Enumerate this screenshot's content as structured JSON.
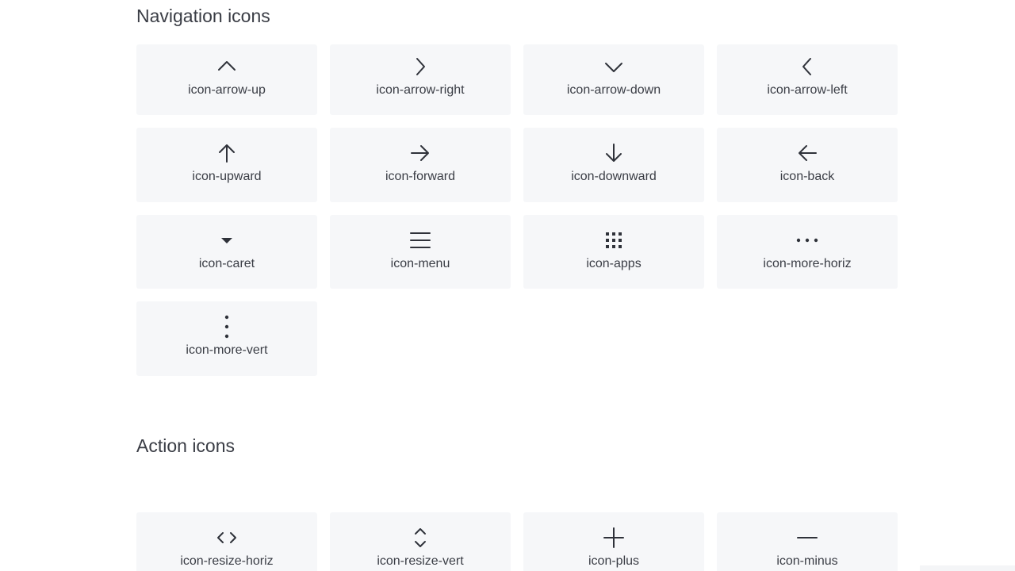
{
  "sections": [
    {
      "title": "Navigation icons",
      "icons": [
        {
          "label": "icon-arrow-up",
          "icon": "chevron-up-icon"
        },
        {
          "label": "icon-arrow-right",
          "icon": "chevron-right-icon"
        },
        {
          "label": "icon-arrow-down",
          "icon": "chevron-down-icon"
        },
        {
          "label": "icon-arrow-left",
          "icon": "chevron-left-icon"
        },
        {
          "label": "icon-upward",
          "icon": "arrow-up-icon"
        },
        {
          "label": "icon-forward",
          "icon": "arrow-right-icon"
        },
        {
          "label": "icon-downward",
          "icon": "arrow-down-icon"
        },
        {
          "label": "icon-back",
          "icon": "arrow-left-icon"
        },
        {
          "label": "icon-caret",
          "icon": "caret-down-icon"
        },
        {
          "label": "icon-menu",
          "icon": "hamburger-menu-icon"
        },
        {
          "label": "icon-apps",
          "icon": "apps-grid-icon"
        },
        {
          "label": "icon-more-horiz",
          "icon": "more-horizontal-icon"
        },
        {
          "label": "icon-more-vert",
          "icon": "more-vertical-icon"
        }
      ]
    },
    {
      "title": "Action icons",
      "icons": [
        {
          "label": "icon-resize-horiz",
          "icon": "resize-horizontal-icon"
        },
        {
          "label": "icon-resize-vert",
          "icon": "resize-vertical-icon"
        },
        {
          "label": "icon-plus",
          "icon": "plus-icon"
        },
        {
          "label": "icon-minus",
          "icon": "minus-icon"
        }
      ]
    }
  ],
  "colors": {
    "tile_background": "#f6f7f9",
    "text": "#3a3d45",
    "icon_stroke": "#2f323a"
  }
}
